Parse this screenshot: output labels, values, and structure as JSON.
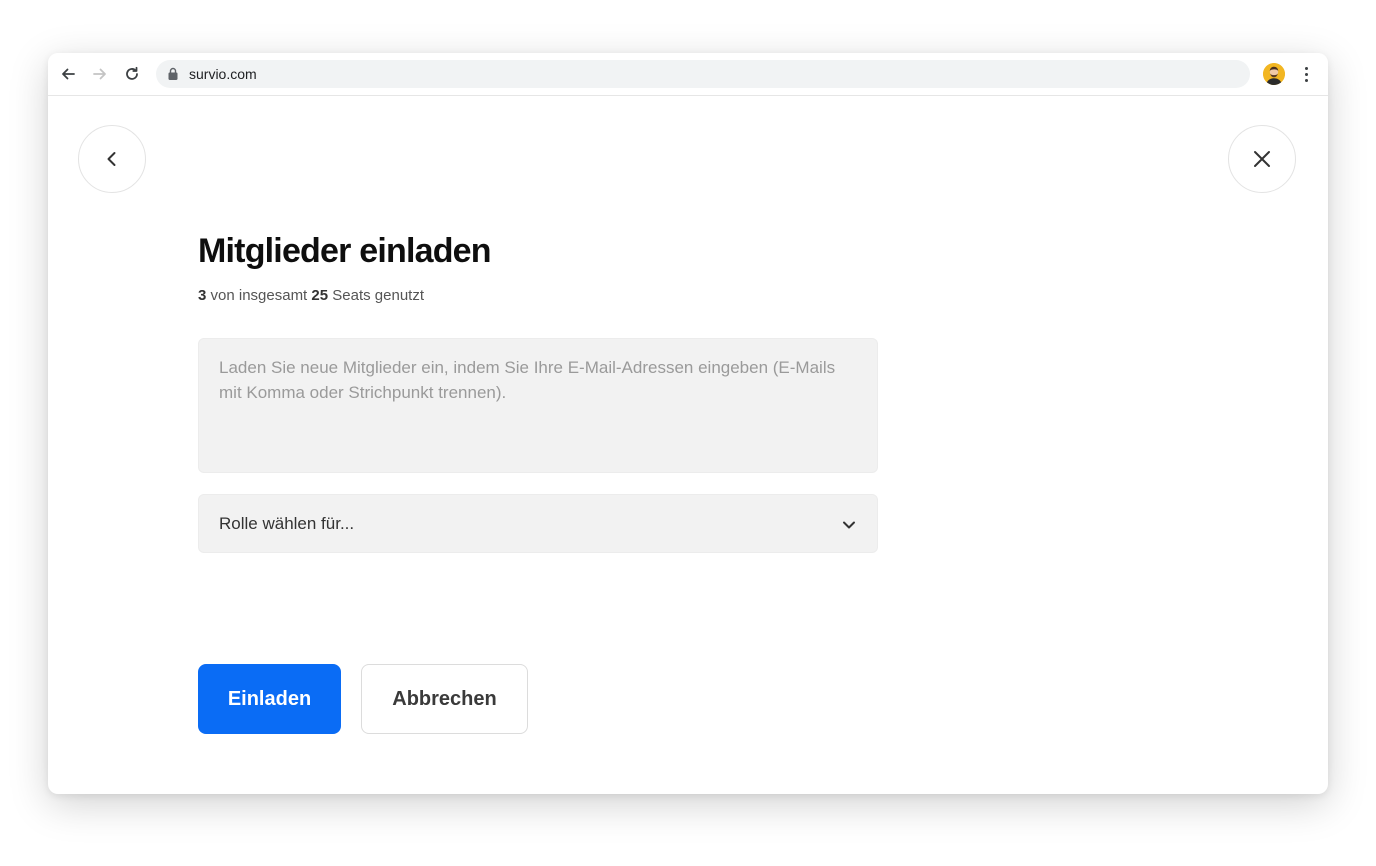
{
  "browser": {
    "url": "survio.com",
    "icons": {
      "back": "arrow-left-icon",
      "forward": "arrow-right-icon",
      "reload": "reload-icon",
      "lock": "lock-icon",
      "menu": "more-vert-icon"
    }
  },
  "dialog": {
    "title": "Mitglieder einladen",
    "seats": {
      "used": "3",
      "text_mid": " von insgesamt ",
      "total": "25",
      "text_end": " Seats genutzt"
    },
    "email_input": {
      "value": "",
      "placeholder": "Laden Sie neue Mitglieder ein, indem Sie Ihre E-Mail-Adressen eingeben (E-Mails mit Komma oder Strichpunkt trennen)."
    },
    "role_select": {
      "label": "Rolle wählen für..."
    },
    "buttons": {
      "invite": "Einladen",
      "cancel": "Abbrechen"
    }
  },
  "colors": {
    "primary": "#0a6cf5",
    "field_bg": "#f2f2f2",
    "title": "#0e0e0e"
  }
}
